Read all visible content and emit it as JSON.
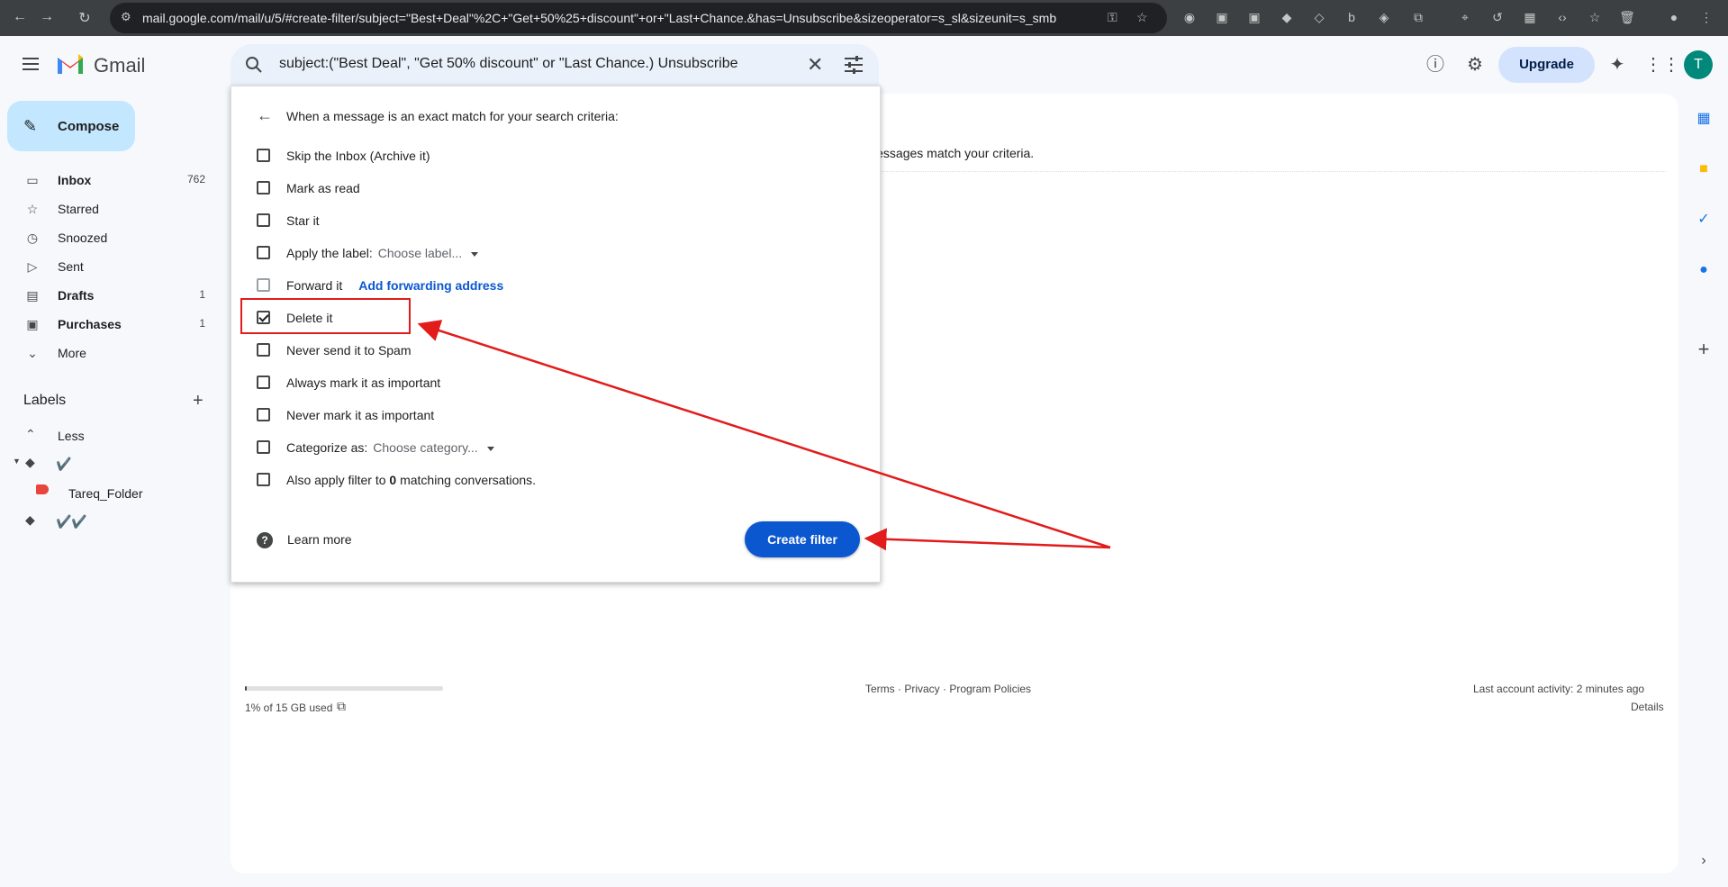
{
  "browser": {
    "url": "mail.google.com/mail/u/5/#create-filter/subject=\"Best+Deal\"%2C+\"Get+50%25+discount\"+or+\"Last+Chance.&has=Unsubscribe&sizeoperator=s_sl&sizeunit=s_smb"
  },
  "header": {
    "app_name": "Gmail",
    "search_query": "subject:(\"Best Deal\", \"Get 50% discount\" or \"Last Chance.) Unsubscribe",
    "upgrade_label": "Upgrade",
    "avatar_letter": "T"
  },
  "sidebar": {
    "compose_label": "Compose",
    "items": [
      {
        "label": "Inbox",
        "count": "762",
        "icon": "inbox-icon"
      },
      {
        "label": "Starred",
        "count": "",
        "icon": "star-icon"
      },
      {
        "label": "Snoozed",
        "count": "",
        "icon": "clock-icon"
      },
      {
        "label": "Sent",
        "count": "",
        "icon": "send-icon"
      },
      {
        "label": "Drafts",
        "count": "1",
        "icon": "draft-icon"
      },
      {
        "label": "Purchases",
        "count": "1",
        "icon": "bag-icon"
      },
      {
        "label": "More",
        "count": "",
        "icon": "chevron-down-icon"
      }
    ],
    "labels_heading": "Labels",
    "less_label": "Less",
    "label_1": "✔️",
    "label_sub": "Tareq_Folder",
    "label_2": "✔️✔️"
  },
  "filter_panel": {
    "heading": "When a message is an exact match for your search criteria:",
    "options": [
      {
        "label": "Skip the Inbox (Archive it)",
        "checked": false
      },
      {
        "label": "Mark as read",
        "checked": false
      },
      {
        "label": "Star it",
        "checked": false
      },
      {
        "label": "Apply the label:",
        "checked": false,
        "select": "Choose label..."
      },
      {
        "label": "Forward it",
        "checked": false,
        "link": "Add forwarding address"
      },
      {
        "label": "Delete it",
        "checked": true
      },
      {
        "label": "Never send it to Spam",
        "checked": false
      },
      {
        "label": "Always mark it as important",
        "checked": false
      },
      {
        "label": "Never mark it as important",
        "checked": false
      },
      {
        "label": "Categorize as:",
        "checked": false,
        "select": "Choose category..."
      },
      {
        "label": "Also apply filter to",
        "bold": "0",
        "suffix": "matching conversations.",
        "checked": false
      }
    ],
    "learn_more": "Learn more",
    "create_filter": "Create filter"
  },
  "main": {
    "background_text": "ng messages match your criteria."
  },
  "footer": {
    "storage": "1% of 15 GB used",
    "storage_fraction": 0.01,
    "links": "Terms · Privacy · Program Policies",
    "activity": "Last account activity: 2 minutes ago",
    "details": "Details"
  },
  "colors": {
    "accent": "#0b57d0",
    "annotation": "#e21b1b"
  }
}
